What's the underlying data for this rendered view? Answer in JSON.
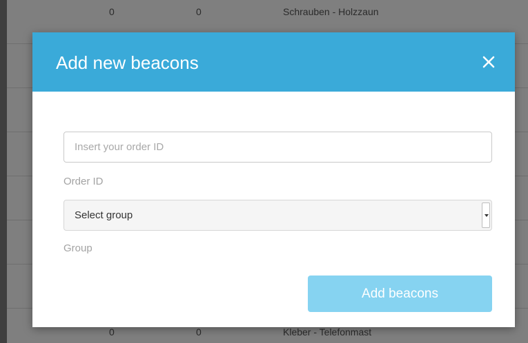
{
  "background_table": {
    "top_row": {
      "col1": "0",
      "col2": "0",
      "col3": "Schrauben - Holzzaun"
    },
    "bottom_row": {
      "col1": "0",
      "col2": "0",
      "col3": "Kleber - Telefonmast"
    }
  },
  "modal": {
    "title": "Add new beacons",
    "close_symbol": "×",
    "order_id": {
      "placeholder": "Insert your order ID",
      "value": "",
      "label": "Order ID"
    },
    "group": {
      "selected": "Select group",
      "label": "Group"
    },
    "submit_label": "Add beacons",
    "header_color": "#3aaad9",
    "button_color": "#86d3f1"
  },
  "icons": {
    "close": "close-icon",
    "dropdown": "chevron-down-icon"
  }
}
